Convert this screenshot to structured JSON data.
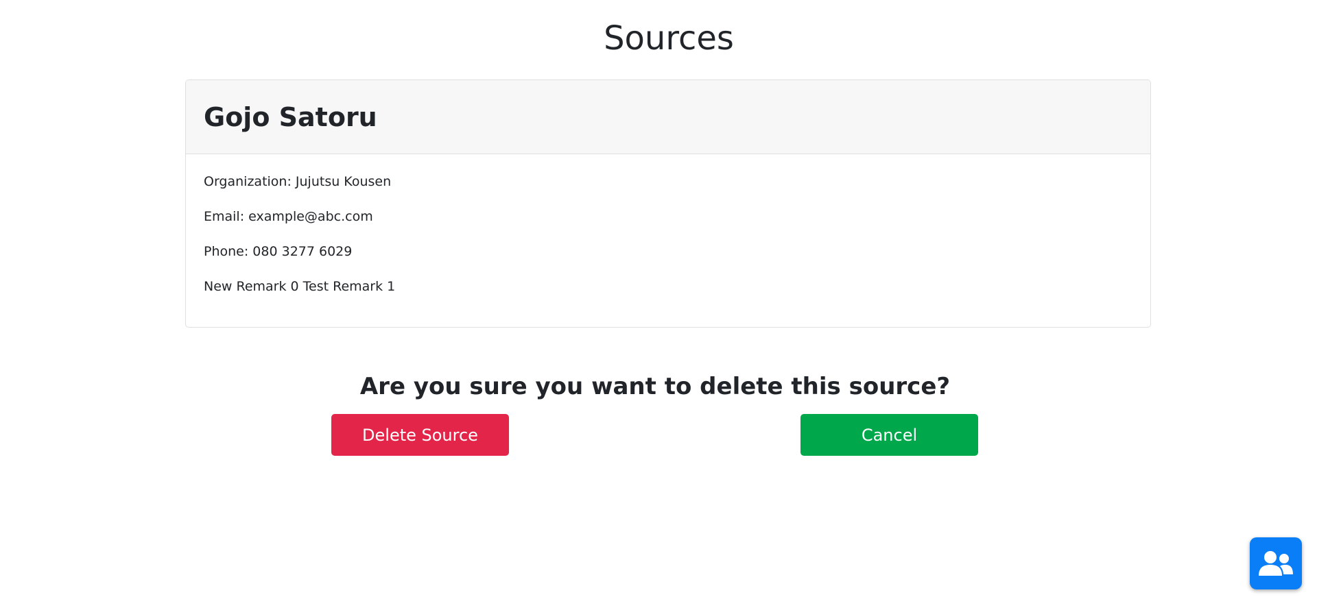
{
  "page": {
    "title": "Sources"
  },
  "source": {
    "name": "Gojo Satoru",
    "organization": "Organization: Jujutsu Kousen",
    "email": "Email: example@abc.com",
    "phone": "Phone: 080 3277 6029",
    "remarks": "New Remark 0 Test Remark 1"
  },
  "confirm": {
    "question": "Are you sure you want to delete this source?",
    "delete_label": "Delete Source",
    "cancel_label": "Cancel"
  },
  "fab": {
    "icon": "users-icon"
  },
  "colors": {
    "delete": "#e4254a",
    "cancel": "#00a84b",
    "fab": "#0a7ef7"
  }
}
